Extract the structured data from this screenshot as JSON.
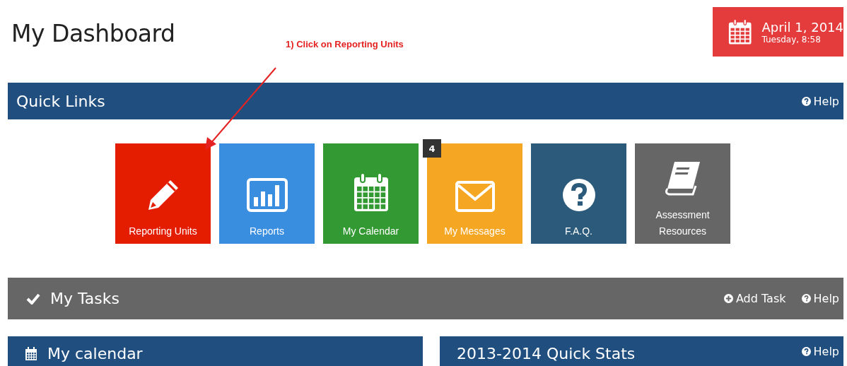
{
  "page_title": "My Dashboard",
  "date_box": {
    "date": "April 1, 2014",
    "time": "Tuesday, 8:58"
  },
  "annotation": {
    "text": "1) Click on Reporting Units"
  },
  "quick_links": {
    "title": "Quick Links",
    "help": "Help",
    "tiles": [
      {
        "kind": "pencil",
        "label": "Reporting Units",
        "color": "#e41c00"
      },
      {
        "kind": "chart",
        "label": "Reports",
        "color": "#3a8ee0"
      },
      {
        "kind": "calendar",
        "label": "My Calendar",
        "color": "#339933"
      },
      {
        "kind": "mail",
        "label": "My Messages",
        "color": "#f5a623",
        "badge": "4"
      },
      {
        "kind": "question",
        "label": "F.A.Q.",
        "color": "#2c5a7a"
      },
      {
        "kind": "book",
        "label": "Assessment Resources",
        "color": "#666666"
      }
    ]
  },
  "tasks": {
    "title": "My Tasks",
    "add": "Add Task",
    "help": "Help"
  },
  "calendar_panel": {
    "title": "My calendar"
  },
  "stats_panel": {
    "title": "2013-2014 Quick Stats",
    "help": "Help"
  }
}
